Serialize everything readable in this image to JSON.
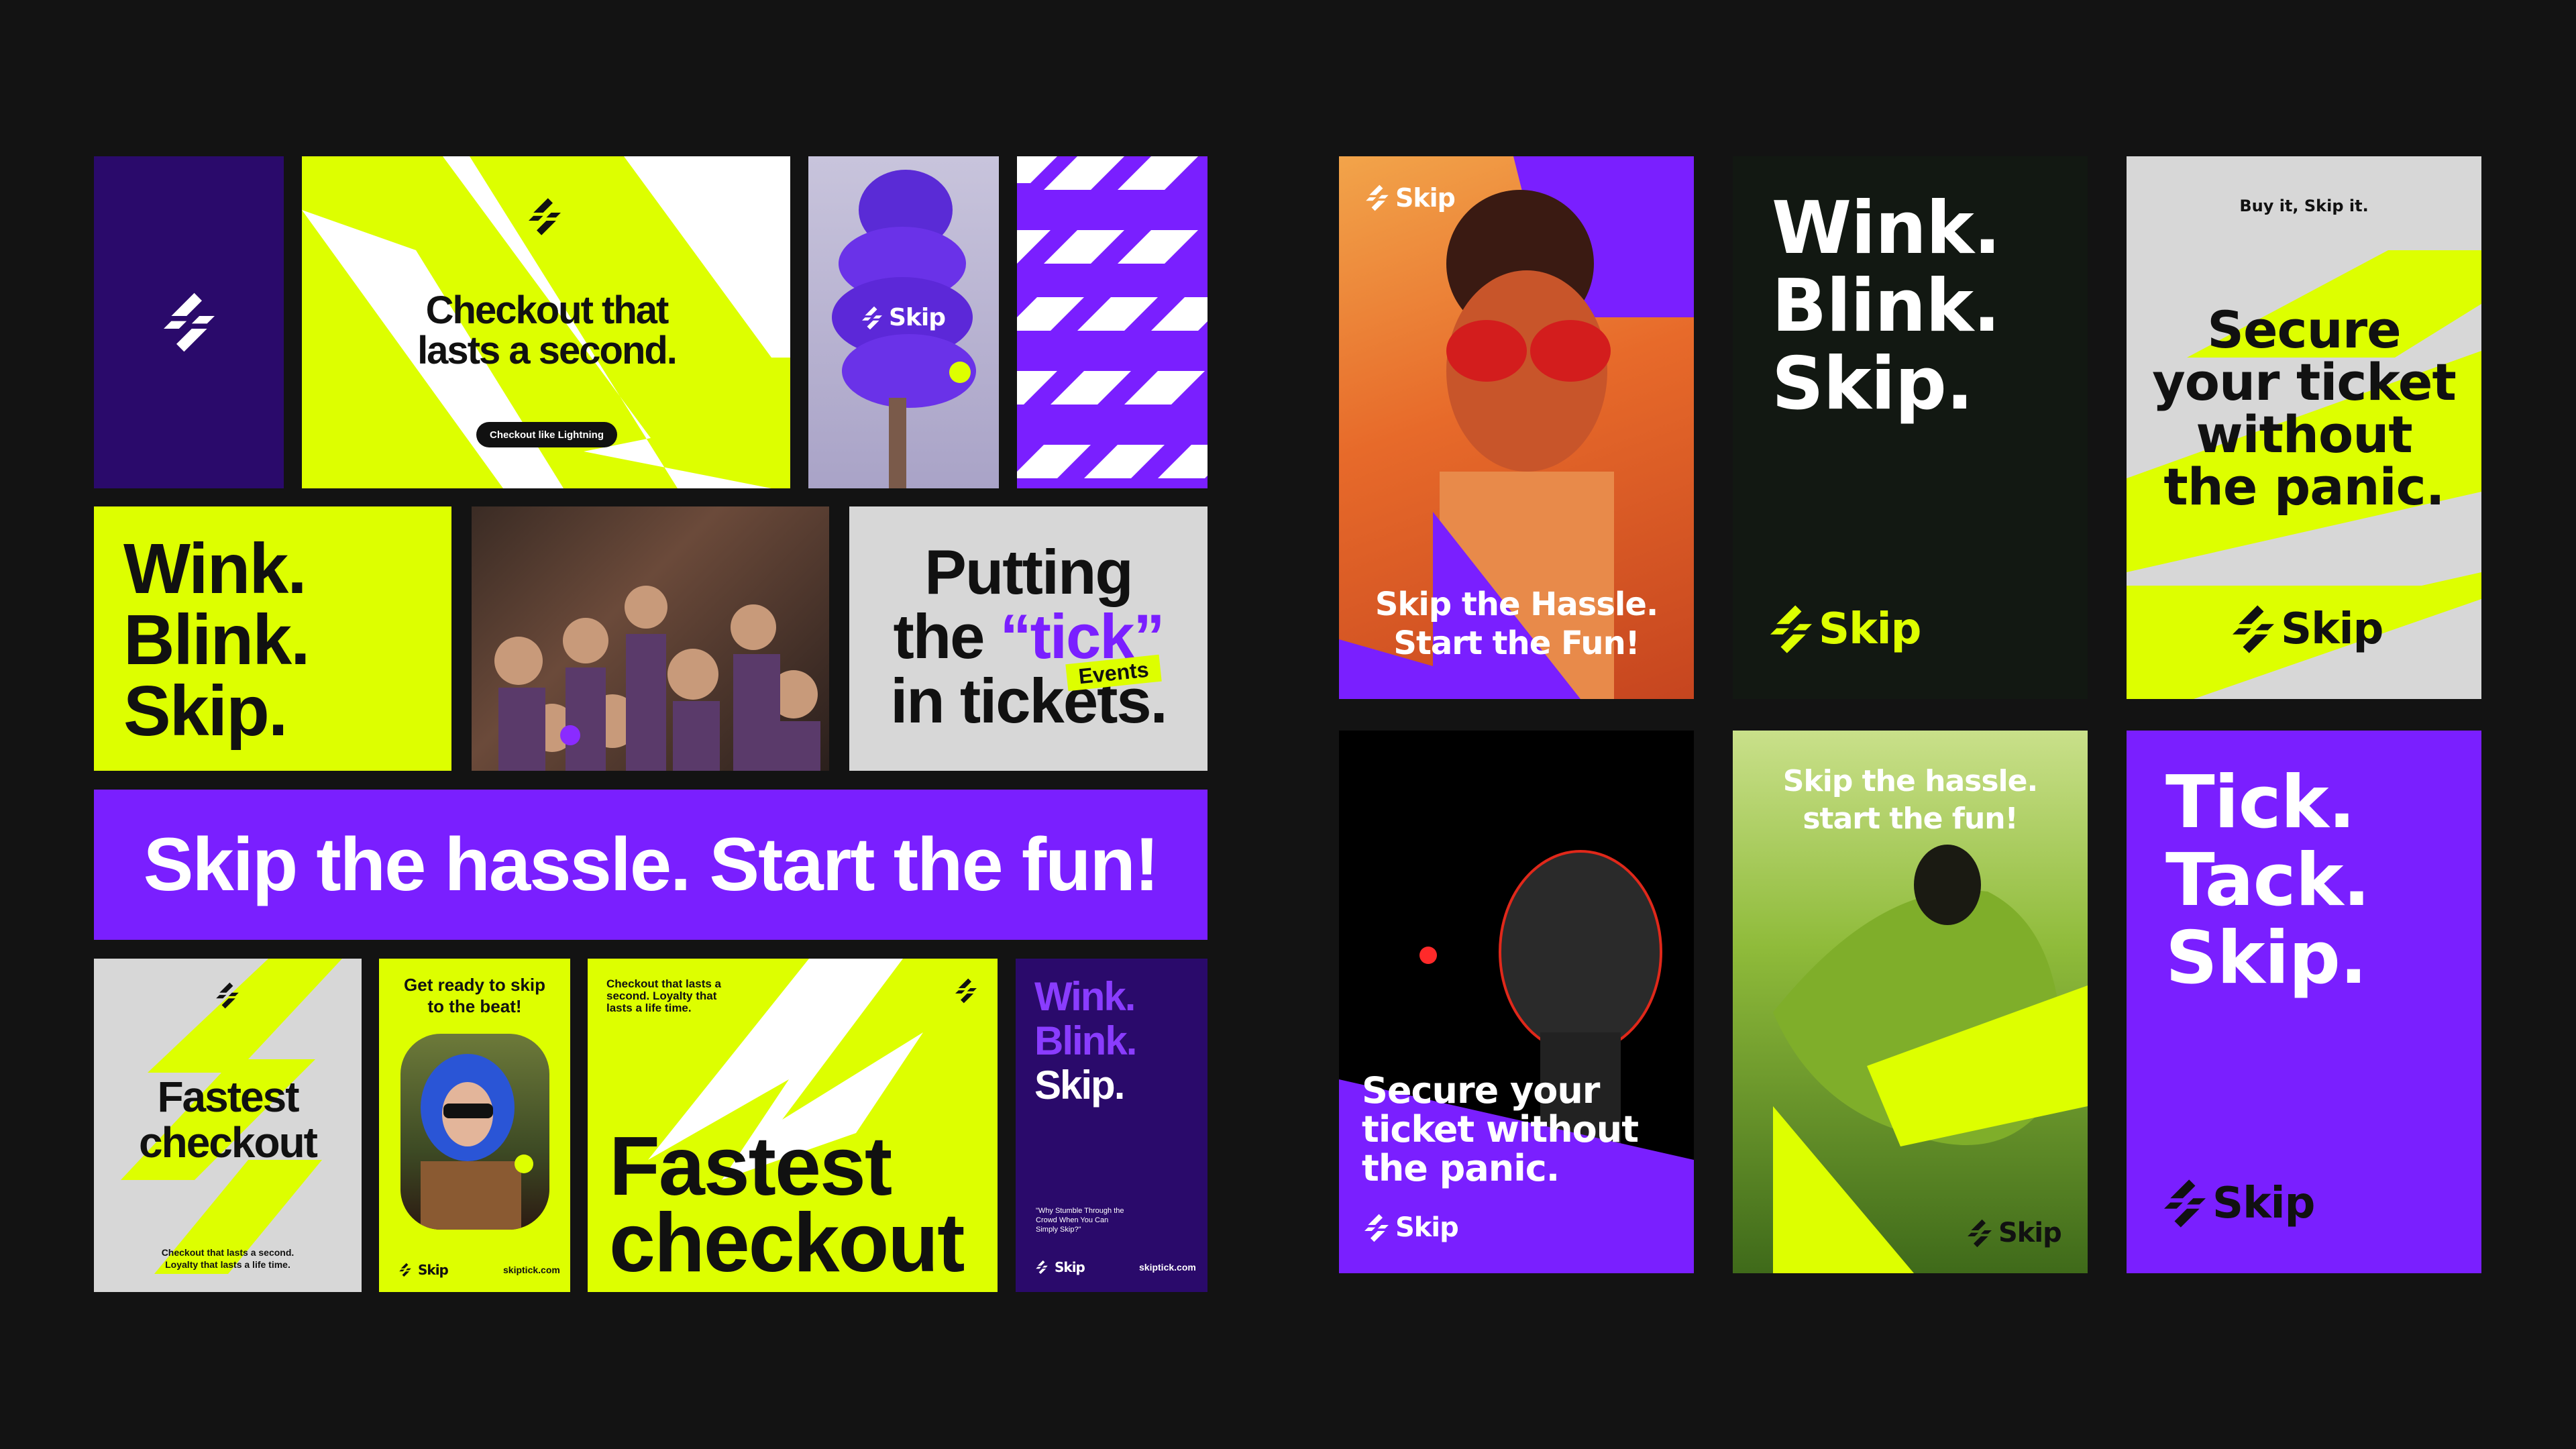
{
  "brand": {
    "name": "Skip"
  },
  "colors": {
    "lime": "#DDFF00",
    "purple": "#7A1FFF",
    "dark_purple": "#2A0A6B",
    "grey": "#D7D7D7",
    "dark": "#121812",
    "background": "#131313"
  },
  "left": {
    "lightning_poster": {
      "headline": "Checkout that lasts a second.",
      "pill": "Checkout like Lightning"
    },
    "wink_poster": {
      "lines": [
        "Wink.",
        "Blink.",
        "Skip."
      ]
    },
    "tick_poster": {
      "line1": "Putting",
      "line2a": "the ",
      "line2b": "“tick”",
      "line3": "in tickets.",
      "tag": "Events"
    },
    "banner": {
      "text": "Skip the hassle. Start the fun!"
    },
    "fastest_grey": {
      "line1": "Fastest",
      "line2": "checkout",
      "footer1": "Checkout that lasts a second.",
      "footer2": "Loyalty that lasts a life time."
    },
    "beat_poster": {
      "line1": "Get ready to skip",
      "line2": "to the beat!",
      "url": "skiptick.com"
    },
    "fastest_lime": {
      "top1": "Checkout that lasts a",
      "top2": "second. Loyalty that",
      "top3": "lasts a life time.",
      "line1": "Fastest",
      "line2": "checkout"
    },
    "wink_purple": {
      "l1": "Wink.",
      "l2": "Blink.",
      "l3": "Skip.",
      "quote1": "\"Why Stumble Through the",
      "quote2": "Crowd When You Can",
      "quote3": "Simply Skip?\"",
      "url": "skiptick.com"
    }
  },
  "right": {
    "hassle_poster": {
      "line1": "Skip the Hassle.",
      "line2": "Start the Fun!"
    },
    "wink_black": {
      "l1": "Wink.",
      "l2": "Blink.",
      "l3": "Skip."
    },
    "secure_grey": {
      "top": "Buy it, Skip it.",
      "l1": "Secure",
      "l2": "your ticket",
      "l3": "without",
      "l4": "the panic."
    },
    "secure_dark": {
      "l1": "Secure your",
      "l2": "ticket without",
      "l3": "the panic."
    },
    "green_poster": {
      "l1": "Skip the hassle.",
      "l2": "start the fun!"
    },
    "tick_purple": {
      "l1": "Tick.",
      "l2": "Tack.",
      "l3": "Skip."
    }
  }
}
